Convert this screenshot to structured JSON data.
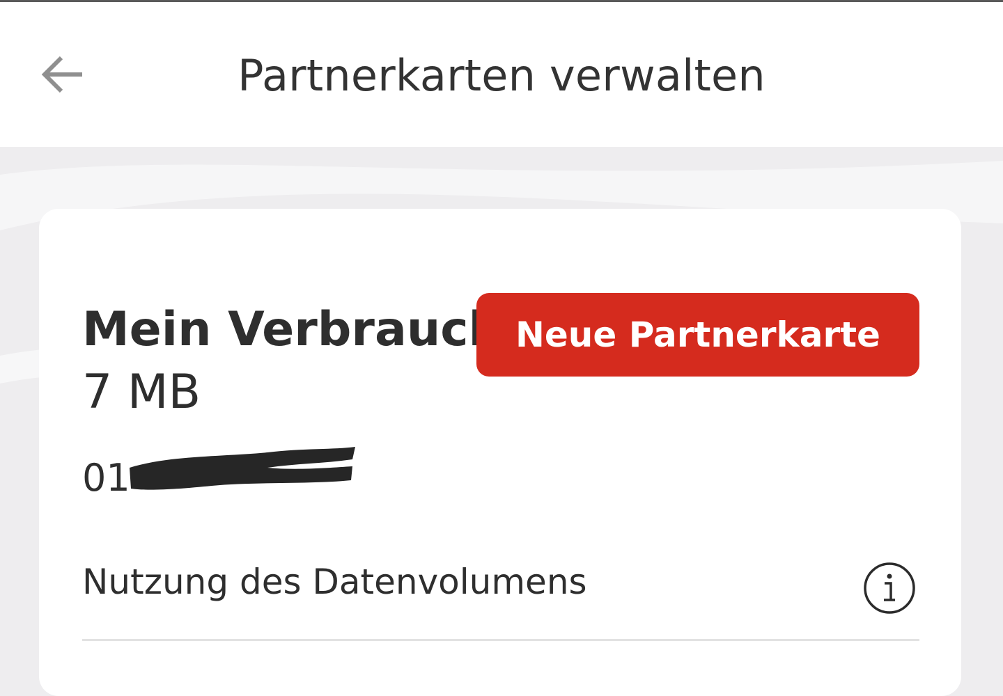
{
  "header": {
    "title": "Partnerkarten verwalten",
    "back_icon": "arrow-left-icon"
  },
  "usage": {
    "label": "Mein Verbrauch:",
    "value": "7 MB"
  },
  "new_card_button": {
    "label": "Neue Partnerkarte"
  },
  "phone": {
    "visible_prefix": "01"
  },
  "data_usage": {
    "label": "Nutzung des Datenvolumens",
    "info_icon": "info-icon"
  },
  "colors": {
    "accent": "#d52b1e",
    "background": "#eeedef",
    "card": "#ffffff",
    "text": "#2e2e2e"
  }
}
